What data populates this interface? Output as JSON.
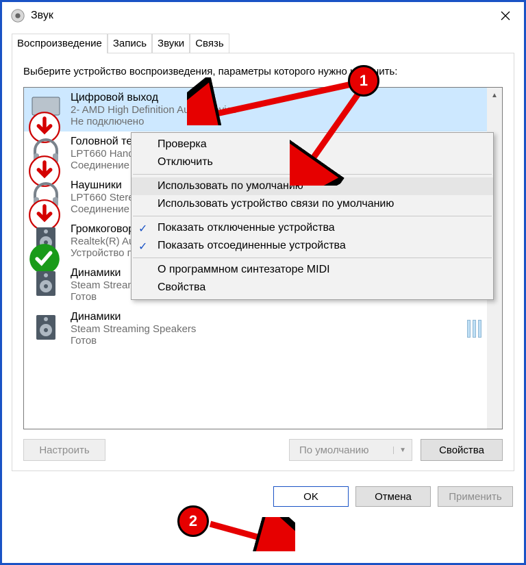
{
  "window": {
    "title": "Звук"
  },
  "tabs": [
    "Воспроизведение",
    "Запись",
    "Звуки",
    "Связь"
  ],
  "active_tab": 0,
  "instruction": "Выберите устройство воспроизведения, параметры которого нужно изменить:",
  "devices": [
    {
      "name": "Цифровой выход",
      "sub": "2- AMD High Definition Audio Device",
      "status": "Не подключено",
      "icon": "monitor",
      "overlay": "down-red",
      "selected": true
    },
    {
      "name": "Головной телефон",
      "sub": "LPT660 Hands-Free",
      "status": "Соединение прервано",
      "icon": "headset",
      "overlay": "down-red",
      "selected": false
    },
    {
      "name": "Наушники",
      "sub": "LPT660 Stereo",
      "status": "Соединение прервано",
      "icon": "headphones",
      "overlay": "down-red",
      "selected": false
    },
    {
      "name": "Громкоговорители",
      "sub": "Realtek(R) Audio",
      "status": "Устройство по умолчанию",
      "icon": "speaker-box",
      "overlay": "check-green",
      "selected": false
    },
    {
      "name": "Динамики",
      "sub": "Steam Streaming Microphone",
      "status": "Готов",
      "icon": "speaker-box",
      "overlay": "",
      "selected": false
    },
    {
      "name": "Динамики",
      "sub": "Steam Streaming Speakers",
      "status": "Готов",
      "icon": "speaker-box",
      "overlay": "",
      "selected": false
    }
  ],
  "context_menu": {
    "items": [
      {
        "label": "Проверка",
        "checked": false,
        "hover": false
      },
      {
        "label": "Отключить",
        "checked": false,
        "hover": false
      },
      {
        "sep": true
      },
      {
        "label": "Использовать по умолчанию",
        "checked": false,
        "hover": true
      },
      {
        "label": "Использовать устройство связи по умолчанию",
        "checked": false,
        "hover": false
      },
      {
        "sep": true
      },
      {
        "label": "Показать отключенные устройства",
        "checked": true,
        "hover": false
      },
      {
        "label": "Показать отсоединенные устройства",
        "checked": true,
        "hover": false
      },
      {
        "sep": true
      },
      {
        "label": "О программном синтезаторе MIDI",
        "checked": false,
        "hover": false
      },
      {
        "label": "Свойства",
        "checked": false,
        "hover": false
      }
    ]
  },
  "bottom": {
    "configure": "Настроить",
    "set_default": "По умолчанию",
    "properties": "Свойства"
  },
  "dialog_buttons": {
    "ok": "OK",
    "cancel": "Отмена",
    "apply": "Применить"
  },
  "annotations": {
    "badge1": "1",
    "badge2": "2"
  }
}
